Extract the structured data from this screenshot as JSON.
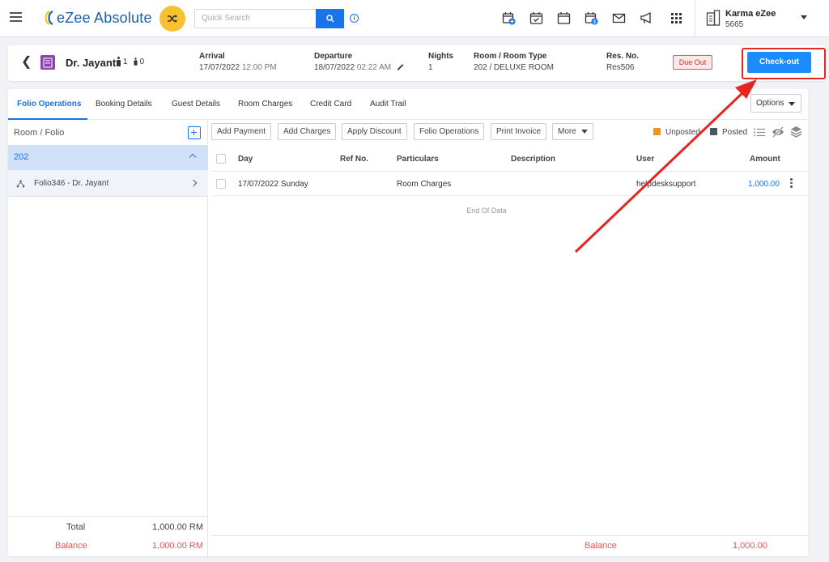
{
  "app": {
    "title": "eZee Absolute"
  },
  "search": {
    "placeholder": "Quick Search"
  },
  "property": {
    "name": "Karma eZee",
    "code": "5665"
  },
  "colors": {
    "brand_blue": "#1a73e8",
    "accent_yellow": "#f7c12f",
    "annotation_red": "#e52521",
    "balance_red": "#e55555"
  },
  "top_icons": [
    "calendar-add-icon",
    "calendar-check-icon",
    "calendar-icon",
    "calendar-dollar-icon",
    "mail-icon",
    "megaphone-icon",
    "apps-grid-icon"
  ],
  "reservation": {
    "guest_name": "Dr. Jayant",
    "adults": "1",
    "children": "0",
    "arrival_label": "Arrival",
    "arrival_date": "17/07/2022",
    "arrival_time": "12:00 PM",
    "departure_label": "Departure",
    "departure_date": "18/07/2022",
    "departure_time": "02:22 AM",
    "nights_label": "Nights",
    "nights": "1",
    "room_label": "Room / Room Type",
    "room": "202 / DELUXE ROOM",
    "res_no_label": "Res. No.",
    "res_no": "Res506",
    "status_badge": "Due Out",
    "checkout_label": "Check-out"
  },
  "tabs": [
    {
      "label": "Folio Operations",
      "active": true
    },
    {
      "label": "Booking Details"
    },
    {
      "label": "Guest Details"
    },
    {
      "label": "Room Charges"
    },
    {
      "label": "Credit Card"
    },
    {
      "label": "Audit Trail"
    }
  ],
  "options_label": "Options",
  "folio_panel": {
    "title": "Room / Folio",
    "room": "202",
    "folio": "Folio346 - Dr. Jayant",
    "total_label": "Total",
    "total_value": "1,000.00 RM",
    "balance_label": "Balance",
    "balance_value": "1,000.00 RM"
  },
  "actions": [
    "Add Payment",
    "Add Charges",
    "Apply Discount",
    "Folio Operations",
    "Print Invoice",
    "More"
  ],
  "legend": {
    "unposted": "Unposted",
    "posted": "Posted",
    "unposted_color": "#f0931f",
    "posted_color": "#4a5568"
  },
  "grid": {
    "columns": [
      "Day",
      "Ref No.",
      "Particulars",
      "Description",
      "User",
      "Amount"
    ],
    "rows": [
      {
        "day": "17/07/2022 Sunday",
        "ref": "",
        "particulars": "Room Charges",
        "description": "",
        "user": "helpdesksupport",
        "amount": "1,000.00"
      }
    ],
    "end_text": "End Of Data"
  },
  "footer": {
    "balance_label": "Balance",
    "balance_value": "1,000.00"
  }
}
